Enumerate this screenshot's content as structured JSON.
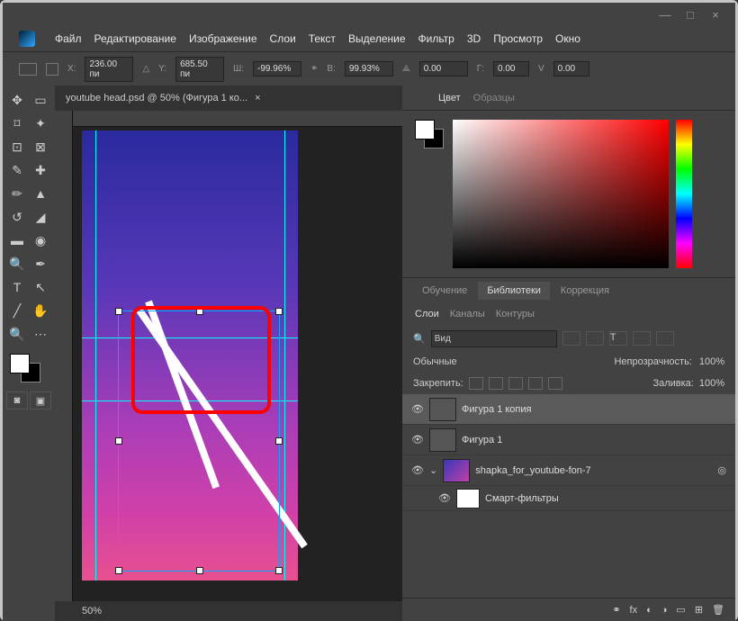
{
  "window": {
    "controls": [
      "—",
      "□",
      "×"
    ]
  },
  "menu": [
    "Файл",
    "Редактирование",
    "Изображение",
    "Слои",
    "Текст",
    "Выделение",
    "Фильтр",
    "3D",
    "Просмотр",
    "Окно"
  ],
  "options": {
    "x_label": "X:",
    "x": "236.00 пи",
    "y_label": "Y:",
    "y": "685.50 пи",
    "w_label": "Ш:",
    "w": "-99.96%",
    "h_label": "В:",
    "h": "99.93%",
    "ang": "0.00",
    "g_label": "Г:",
    "g": "0.00",
    "v_label": "V",
    "v": "0.00"
  },
  "doc": {
    "tab": "youtube head.psd @ 50% (Фигура 1 ко...",
    "close": "×",
    "zoom": "50%"
  },
  "panels": {
    "color_tab": "Цвет",
    "swatches_tab": "Образцы",
    "learn": "Обучение",
    "libs": "Библиотеки",
    "adjust": "Коррекция",
    "layers": "Слои",
    "channels": "Каналы",
    "paths": "Контуры"
  },
  "layer_panel": {
    "search": "Вид",
    "blend": "Обычные",
    "opacity_label": "Непрозрачность:",
    "opacity": "100%",
    "lock_label": "Закрепить:",
    "fill_label": "Заливка:",
    "fill": "100%",
    "l1": "Фигура 1 копия",
    "l2": "Фигура 1",
    "l3": "shapka_for_youtube-fon-7",
    "l4": "Смарт-фильтры"
  }
}
